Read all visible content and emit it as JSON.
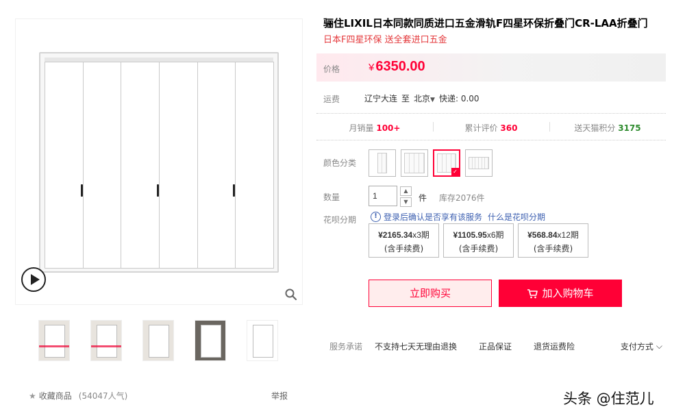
{
  "product": {
    "title": "骊住LIXIL日本同款同质进口五金滑轨F四星环保折叠门CR-LAA折叠门",
    "subtitle": "日本F四星环保 送全套进口五金"
  },
  "price": {
    "label": "价格",
    "symbol": "¥",
    "value": "6350.00"
  },
  "shipping": {
    "label": "运费",
    "from": "辽宁大连",
    "to_prefix": "至",
    "to": "北京",
    "method": "快递: 0.00"
  },
  "stats": {
    "monthly_sales_label": "月销量",
    "monthly_sales_value": "100+",
    "reviews_label": "累计评价",
    "reviews_value": "360",
    "points_label": "送天猫积分",
    "points_value": "3175"
  },
  "variant": {
    "label": "颜色分类",
    "selected_index": 2
  },
  "quantity": {
    "label": "数量",
    "value": "1",
    "unit": "件",
    "stock": "库存2076件"
  },
  "huabei": {
    "label": "花呗分期",
    "note": "登录后确认是否享有该服务",
    "link": "什么是花呗分期",
    "plans": [
      {
        "amount": "¥2165.34",
        "periods": "x3期",
        "fee": "(含手续费)"
      },
      {
        "amount": "¥1105.95",
        "periods": "x6期",
        "fee": "(含手续费)"
      },
      {
        "amount": "¥568.84",
        "periods": "x12期",
        "fee": "(含手续费)"
      }
    ]
  },
  "actions": {
    "buy_now": "立即购买",
    "add_to_cart": "加入购物车"
  },
  "service": {
    "label": "服务承诺",
    "items": [
      "不支持七天无理由退换",
      "正品保证",
      "退货运费险"
    ],
    "payment": "支付方式"
  },
  "gallery": {
    "favorite_label": "收藏商品",
    "popularity": "(54047人气)",
    "report": "举报"
  },
  "watermark": "头条 @住范儿",
  "colors": {
    "accent": "#ff0036",
    "link": "#3c5fb0",
    "points_green": "#2e8b2e"
  }
}
